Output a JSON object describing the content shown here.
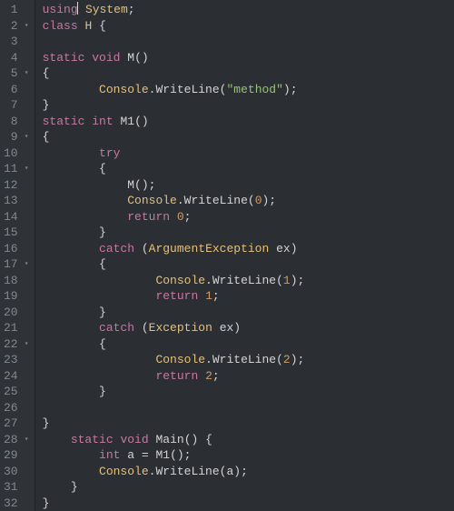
{
  "editor": {
    "language": "csharp",
    "cursor": {
      "line": 1,
      "column": 6
    },
    "lines": [
      {
        "num": 1,
        "fold": false,
        "indent": 0,
        "tokens": [
          [
            "kw",
            "using"
          ],
          [
            "cursor",
            ""
          ],
          [
            "punc",
            " "
          ],
          [
            "type",
            "System"
          ],
          [
            "punc",
            ";"
          ]
        ]
      },
      {
        "num": 2,
        "fold": true,
        "indent": 0,
        "tokens": [
          [
            "kw",
            "class"
          ],
          [
            "punc",
            " "
          ],
          [
            "type",
            "H"
          ],
          [
            "punc",
            " "
          ],
          [
            "brace",
            "{"
          ]
        ]
      },
      {
        "num": 3,
        "fold": false,
        "indent": 0,
        "tokens": []
      },
      {
        "num": 4,
        "fold": false,
        "indent": 0,
        "tokens": [
          [
            "kw",
            "static"
          ],
          [
            "punc",
            " "
          ],
          [
            "kw",
            "void"
          ],
          [
            "punc",
            " "
          ],
          [
            "func",
            "M"
          ],
          [
            "punc",
            "()"
          ]
        ]
      },
      {
        "num": 5,
        "fold": true,
        "indent": 0,
        "tokens": [
          [
            "brace",
            "{"
          ]
        ]
      },
      {
        "num": 6,
        "fold": false,
        "indent": 2,
        "tokens": [
          [
            "type",
            "Console"
          ],
          [
            "punc",
            "."
          ],
          [
            "func",
            "WriteLine"
          ],
          [
            "punc",
            "("
          ],
          [
            "str",
            "\"method\""
          ],
          [
            "punc",
            ");"
          ]
        ]
      },
      {
        "num": 7,
        "fold": false,
        "indent": 0,
        "tokens": [
          [
            "brace",
            "}"
          ]
        ]
      },
      {
        "num": 8,
        "fold": false,
        "indent": 0,
        "tokens": [
          [
            "kw",
            "static"
          ],
          [
            "punc",
            " "
          ],
          [
            "kw",
            "int"
          ],
          [
            "punc",
            " "
          ],
          [
            "func",
            "M1"
          ],
          [
            "punc",
            "()"
          ]
        ]
      },
      {
        "num": 9,
        "fold": true,
        "indent": 0,
        "tokens": [
          [
            "brace",
            "{"
          ]
        ]
      },
      {
        "num": 10,
        "fold": false,
        "indent": 2,
        "tokens": [
          [
            "try",
            "try"
          ]
        ]
      },
      {
        "num": 11,
        "fold": true,
        "indent": 2,
        "tokens": [
          [
            "brace",
            "{"
          ]
        ]
      },
      {
        "num": 12,
        "fold": false,
        "indent": 3,
        "tokens": [
          [
            "func",
            "M"
          ],
          [
            "punc",
            "();"
          ]
        ]
      },
      {
        "num": 13,
        "fold": false,
        "indent": 3,
        "tokens": [
          [
            "type",
            "Console"
          ],
          [
            "punc",
            "."
          ],
          [
            "func",
            "WriteLine"
          ],
          [
            "punc",
            "("
          ],
          [
            "num",
            "0"
          ],
          [
            "punc",
            ");"
          ]
        ]
      },
      {
        "num": 14,
        "fold": false,
        "indent": 3,
        "tokens": [
          [
            "kw",
            "return"
          ],
          [
            "punc",
            " "
          ],
          [
            "num",
            "0"
          ],
          [
            "punc",
            ";"
          ]
        ]
      },
      {
        "num": 15,
        "fold": false,
        "indent": 2,
        "tokens": [
          [
            "brace",
            "}"
          ]
        ]
      },
      {
        "num": 16,
        "fold": false,
        "indent": 2,
        "tokens": [
          [
            "try",
            "catch"
          ],
          [
            "punc",
            " ("
          ],
          [
            "type",
            "ArgumentException"
          ],
          [
            "punc",
            " "
          ],
          [
            "var",
            "ex"
          ],
          [
            "punc",
            ")"
          ]
        ]
      },
      {
        "num": 17,
        "fold": true,
        "indent": 2,
        "tokens": [
          [
            "brace",
            "{"
          ]
        ]
      },
      {
        "num": 18,
        "fold": false,
        "indent": 4,
        "tokens": [
          [
            "type",
            "Console"
          ],
          [
            "punc",
            "."
          ],
          [
            "func",
            "WriteLine"
          ],
          [
            "punc",
            "("
          ],
          [
            "num",
            "1"
          ],
          [
            "punc",
            ");"
          ]
        ]
      },
      {
        "num": 19,
        "fold": false,
        "indent": 4,
        "tokens": [
          [
            "kw",
            "return"
          ],
          [
            "punc",
            " "
          ],
          [
            "num",
            "1"
          ],
          [
            "punc",
            ";"
          ]
        ]
      },
      {
        "num": 20,
        "fold": false,
        "indent": 2,
        "tokens": [
          [
            "brace",
            "}"
          ]
        ]
      },
      {
        "num": 21,
        "fold": false,
        "indent": 2,
        "tokens": [
          [
            "try",
            "catch"
          ],
          [
            "punc",
            " ("
          ],
          [
            "type",
            "Exception"
          ],
          [
            "punc",
            " "
          ],
          [
            "var",
            "ex"
          ],
          [
            "punc",
            ")"
          ]
        ]
      },
      {
        "num": 22,
        "fold": true,
        "indent": 2,
        "tokens": [
          [
            "brace",
            "{"
          ]
        ]
      },
      {
        "num": 23,
        "fold": false,
        "indent": 4,
        "tokens": [
          [
            "type",
            "Console"
          ],
          [
            "punc",
            "."
          ],
          [
            "func",
            "WriteLine"
          ],
          [
            "punc",
            "("
          ],
          [
            "num",
            "2"
          ],
          [
            "punc",
            ");"
          ]
        ]
      },
      {
        "num": 24,
        "fold": false,
        "indent": 4,
        "tokens": [
          [
            "kw",
            "return"
          ],
          [
            "punc",
            " "
          ],
          [
            "num",
            "2"
          ],
          [
            "punc",
            ";"
          ]
        ]
      },
      {
        "num": 25,
        "fold": false,
        "indent": 2,
        "tokens": [
          [
            "brace",
            "}"
          ]
        ]
      },
      {
        "num": 26,
        "fold": false,
        "indent": 0,
        "tokens": []
      },
      {
        "num": 27,
        "fold": false,
        "indent": 0,
        "tokens": [
          [
            "brace",
            "}"
          ]
        ]
      },
      {
        "num": 28,
        "fold": true,
        "indent": 1,
        "tokens": [
          [
            "kw",
            "static"
          ],
          [
            "punc",
            " "
          ],
          [
            "kw",
            "void"
          ],
          [
            "punc",
            " "
          ],
          [
            "func",
            "Main"
          ],
          [
            "punc",
            "() "
          ],
          [
            "brace",
            "{"
          ]
        ]
      },
      {
        "num": 29,
        "fold": false,
        "indent": 2,
        "tokens": [
          [
            "kw",
            "int"
          ],
          [
            "punc",
            " "
          ],
          [
            "var",
            "a"
          ],
          [
            "punc",
            " = "
          ],
          [
            "func",
            "M1"
          ],
          [
            "punc",
            "();"
          ]
        ]
      },
      {
        "num": 30,
        "fold": false,
        "indent": 2,
        "tokens": [
          [
            "type",
            "Console"
          ],
          [
            "punc",
            "."
          ],
          [
            "func",
            "WriteLine"
          ],
          [
            "punc",
            "("
          ],
          [
            "var",
            "a"
          ],
          [
            "punc",
            ");"
          ]
        ]
      },
      {
        "num": 31,
        "fold": false,
        "indent": 1,
        "tokens": [
          [
            "brace",
            "}"
          ]
        ]
      },
      {
        "num": 32,
        "fold": false,
        "indent": 0,
        "tokens": [
          [
            "brace",
            "}"
          ]
        ]
      }
    ]
  },
  "icons": {
    "fold": "▾"
  }
}
